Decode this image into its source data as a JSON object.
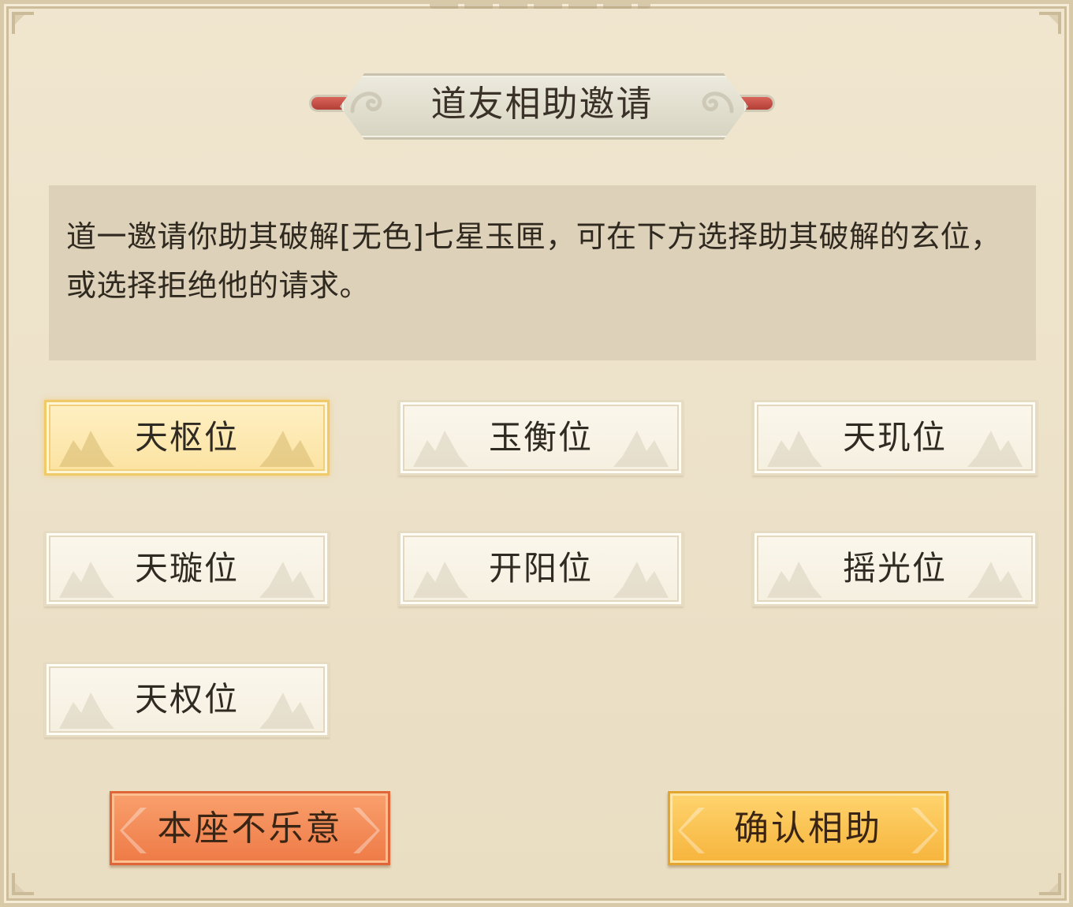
{
  "dialog": {
    "title": "道友相助邀请",
    "message": "道一邀请你助其破解[无色]七星玉匣，可在下方选择助其破解的玄位，或选择拒绝他的请求。"
  },
  "positions": [
    {
      "label": "天枢位",
      "selected": true
    },
    {
      "label": "玉衡位",
      "selected": false
    },
    {
      "label": "天玑位",
      "selected": false
    },
    {
      "label": "天璇位",
      "selected": false
    },
    {
      "label": "开阳位",
      "selected": false
    },
    {
      "label": "摇光位",
      "selected": false
    },
    {
      "label": "天权位",
      "selected": false
    }
  ],
  "actions": {
    "decline_label": "本座不乐意",
    "confirm_label": "确认相助"
  },
  "colors": {
    "panel_bg": "#ece1c8",
    "selected_accent": "#f0c968",
    "decline": "#ee7a46",
    "confirm": "#f6b43c"
  }
}
